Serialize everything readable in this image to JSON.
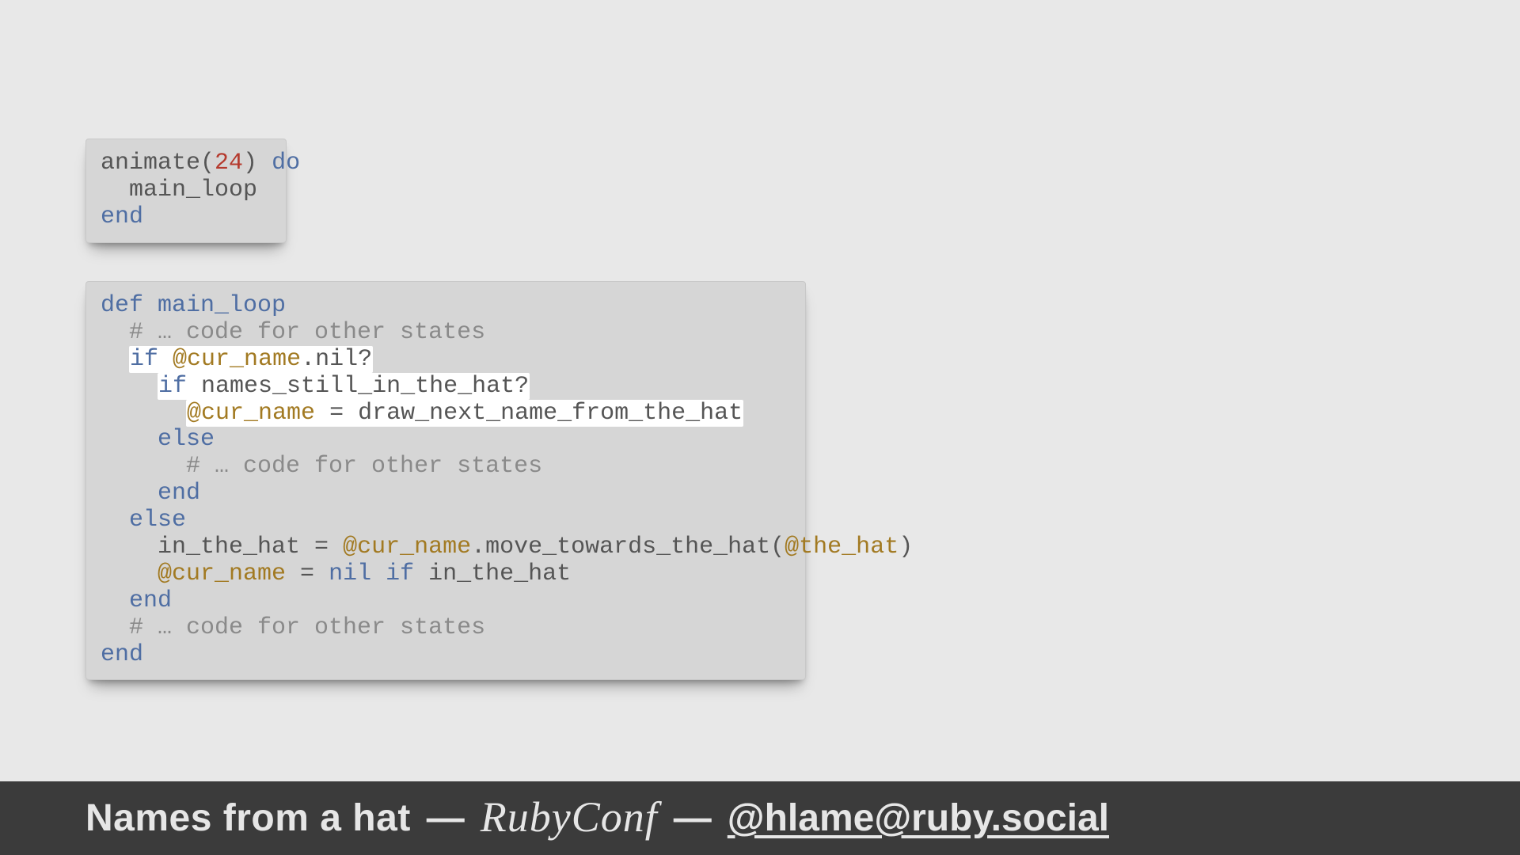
{
  "code1": {
    "l1a": "animate(",
    "l1b": "24",
    "l1c": ") ",
    "l1d": "do",
    "l2": "  main_loop",
    "l3": "end"
  },
  "code2": {
    "l1a": "def",
    "l1b": " main_loop",
    "l2": "  # … code for other states",
    "l3a": "  ",
    "l3b": "if",
    "l3c": " ",
    "l3d": "@cur_name",
    "l3e": ".nil?",
    "l4a": "    ",
    "l4b": "if",
    "l4c": " names_still_in_the_hat?",
    "l5a": "      ",
    "l5b": "@cur_name",
    "l5c": " = draw_next_name_from_the_hat",
    "l6a": "    ",
    "l6b": "else",
    "l7": "      # … code for other states",
    "l8a": "    ",
    "l8b": "end",
    "l9a": "  ",
    "l9b": "else",
    "l10a": "    in_the_hat = ",
    "l10b": "@cur_name",
    "l10c": ".move_towards_the_hat(",
    "l10d": "@the_hat",
    "l10e": ")",
    "l11a": "    ",
    "l11b": "@cur_name",
    "l11c": " = ",
    "l11d": "nil",
    "l11e": " ",
    "l11f": "if",
    "l11g": " in_the_hat",
    "l12a": "  ",
    "l12b": "end",
    "l13": "  # … code for other states",
    "l14": "end"
  },
  "footer": {
    "title": "Names from a hat",
    "sep": "—",
    "logo": "RubyConf",
    "handle": "@hlame@ruby.social"
  }
}
